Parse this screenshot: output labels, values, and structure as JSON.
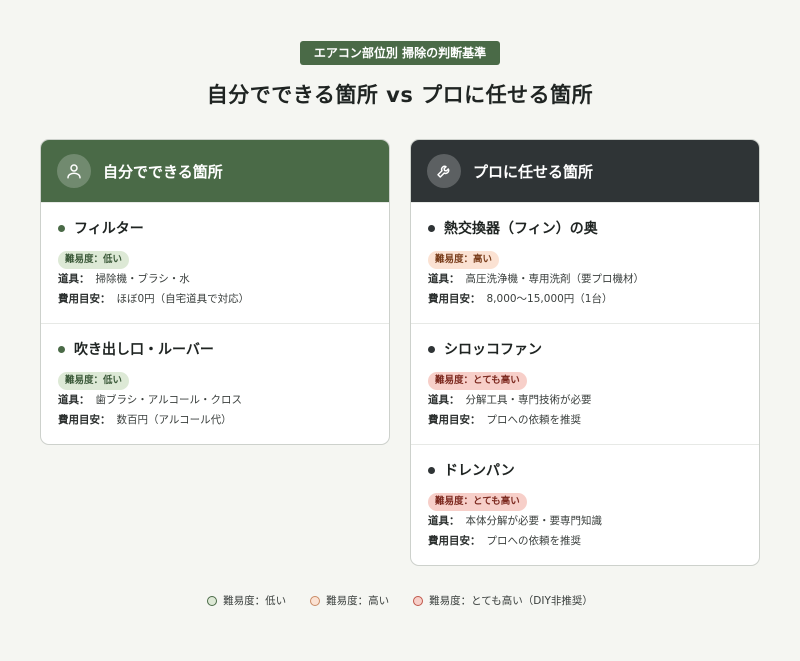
{
  "header": {
    "tag": "エアコン部位別 掃除の判断基準",
    "title": "自分でできる箇所 vs プロに任せる箇所"
  },
  "diy": {
    "title": "自分でできる箇所",
    "icon": "person-icon",
    "items": [
      {
        "name": "フィルター",
        "difficulty": "難易度：低い",
        "tools_label": "道具：",
        "tools": "掃除機・ブラシ・水",
        "cost_label": "費用目安：",
        "cost": "ほぼ0円（自宅道具で対応）"
      },
      {
        "name": "吹き出し口・ルーバー",
        "difficulty": "難易度：低い",
        "tools_label": "道具：",
        "tools": "歯ブラシ・アルコール・クロス",
        "cost_label": "費用目安：",
        "cost": "数百円（アルコール代）"
      }
    ]
  },
  "pro": {
    "title": "プロに任せる箇所",
    "icon": "wrench-icon",
    "items": [
      {
        "name": "熱交換器（フィン）の奥",
        "difficulty": "難易度：高い",
        "tools_label": "道具：",
        "tools": "高圧洗浄機・専用洗剤（要プロ機材）",
        "cost_label": "費用目安：",
        "cost": "8,000〜15,000円（1台）"
      },
      {
        "name": "シロッコファン",
        "difficulty": "難易度：とても高い",
        "tools_label": "道具：",
        "tools": "分解工具・専門技術が必要",
        "cost_label": "費用目安：",
        "cost": "プロへの依頼を推奨"
      },
      {
        "name": "ドレンパン",
        "difficulty": "難易度：とても高い",
        "tools_label": "道具：",
        "tools": "本体分解が必要・要専門知識",
        "cost_label": "費用目安：",
        "cost": "プロへの依頼を推奨"
      }
    ]
  },
  "legend": [
    {
      "label": "難易度：低い",
      "fill": "#dde9d6",
      "stroke": "#4a6a47"
    },
    {
      "label": "難易度：高い",
      "fill": "#fbe2d3",
      "stroke": "#c98a64"
    },
    {
      "label": "難易度：とても高い（DIY非推奨）",
      "fill": "#f7cfc9",
      "stroke": "#c0574a"
    }
  ],
  "colors": {
    "diy_accent": "#4a6a47",
    "pro_accent": "#2f3436",
    "background": "#f5f6f2"
  }
}
